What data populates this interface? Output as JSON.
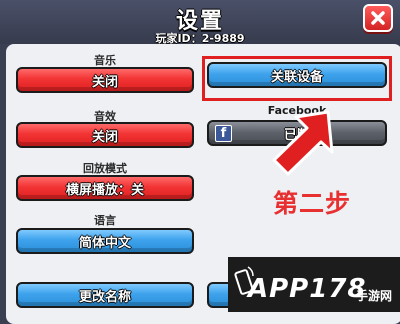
{
  "header": {
    "title": "设置",
    "player_id": "玩家ID：2-9889"
  },
  "sections": {
    "music": {
      "label": "音乐",
      "button": "关闭"
    },
    "sound": {
      "label": "音效",
      "button": "关闭"
    },
    "replay": {
      "label": "回放模式",
      "button": "横屏播放：关"
    },
    "language": {
      "label": "语言",
      "button": "简体中文"
    },
    "rename": {
      "button": "更改名称"
    },
    "link_device": {
      "button": "关联设备"
    },
    "facebook": {
      "label": "Facebook",
      "button": "已断"
    }
  },
  "annotation": {
    "step_text": "第二步"
  },
  "watermark": {
    "text": "APP178",
    "sub": "手游网"
  },
  "colors": {
    "red_button": "#f23434",
    "blue_button": "#3ea3ec",
    "gray_button": "#5c6068",
    "annotation_red": "#e02020"
  }
}
